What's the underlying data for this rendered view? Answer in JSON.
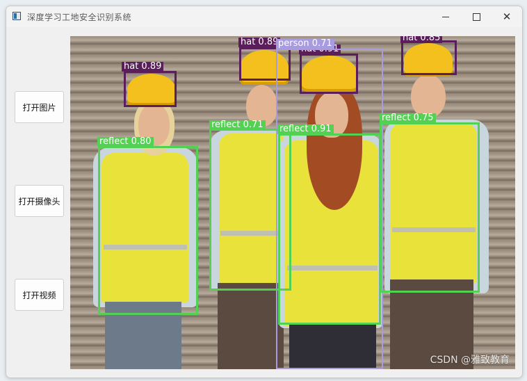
{
  "window": {
    "title": "深度学习工地安全识别系统"
  },
  "buttons": {
    "open_image": "打开图片",
    "open_camera": "打开摄像头",
    "open_video": "打开视频"
  },
  "detections": [
    {
      "label": "hat 0.89",
      "color": "#5a1f5a"
    },
    {
      "label": "hat 0.89",
      "color": "#5a1f5a"
    },
    {
      "label": "hat 0.91",
      "color": "#5a1f5a"
    },
    {
      "label": "hat 0.85",
      "color": "#5a1f5a"
    },
    {
      "label": "person 0.71",
      "color": "#a89be0"
    },
    {
      "label": "reflect 0.80",
      "color": "#52d152"
    },
    {
      "label": "reflect 0.71",
      "color": "#52d152"
    },
    {
      "label": "reflect 0.91",
      "color": "#52d152"
    },
    {
      "label": "reflect 0.75",
      "color": "#52d152"
    }
  ],
  "watermark": "CSDN @雅致教育",
  "icons": {
    "app": "app-icon",
    "minimize": "minimize-icon",
    "maximize": "maximize-icon",
    "close": "close-icon"
  }
}
